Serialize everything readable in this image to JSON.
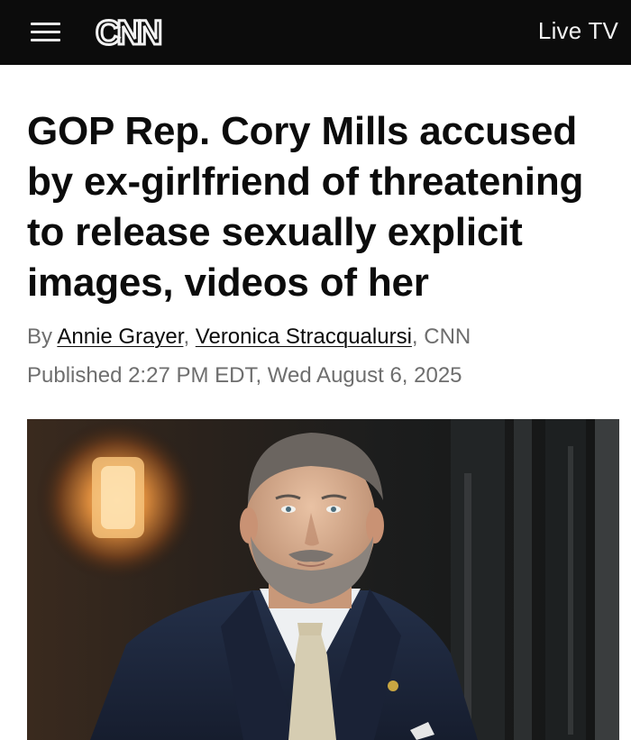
{
  "header": {
    "menu_icon": "hamburger-menu-icon",
    "logo_text": "CNN",
    "live_tv_label": "Live TV",
    "background_color": "#0c0c0c"
  },
  "article": {
    "headline": "GOP Rep. Cory Mills accused by ex-girlfriend of threatening to release sexually explicit images, videos of her",
    "byline_prefix": "By ",
    "authors": [
      "Annie Grayer",
      "Veronica Stracqualursi"
    ],
    "byline_separator": ", ",
    "byline_suffix": ", CNN",
    "published": "Published 2:27 PM EDT, Wed August 6, 2025"
  }
}
